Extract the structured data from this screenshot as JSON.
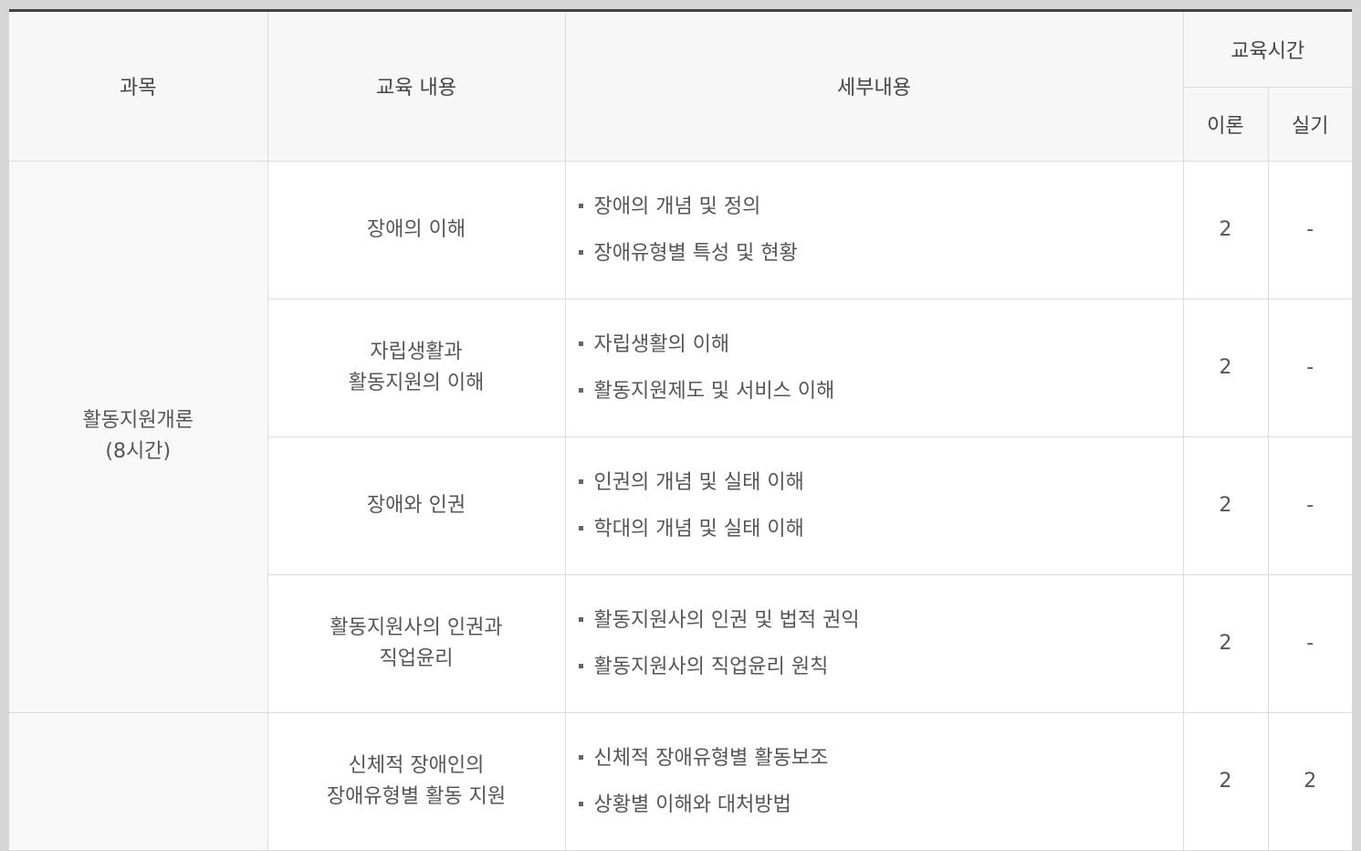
{
  "headers": {
    "subject": "과목",
    "content": "교육 내용",
    "detail": "세부내용",
    "hours": "교육시간",
    "theory": "이론",
    "practice": "실기"
  },
  "groups": [
    {
      "subject": [
        "활동지원개론",
        "(8시간)"
      ],
      "rows": [
        {
          "content": [
            "장애의 이해"
          ],
          "details": [
            "장애의 개념 및 정의",
            "장애유형별 특성 및 현황"
          ],
          "theory": "2",
          "practice": "-"
        },
        {
          "content": [
            "자립생활과",
            "활동지원의 이해"
          ],
          "details": [
            "자립생활의 이해",
            "활동지원제도 및 서비스 이해"
          ],
          "theory": "2",
          "practice": "-"
        },
        {
          "content": [
            "장애와 인권"
          ],
          "details": [
            "인권의 개념 및 실태 이해",
            "학대의 개념 및 실태 이해"
          ],
          "theory": "2",
          "practice": "-"
        },
        {
          "content": [
            "활동지원사의 인권과",
            "직업윤리"
          ],
          "details": [
            "활동지원사의 인권 및 법적 권익",
            "활동지원사의 직업윤리 원칙"
          ],
          "theory": "2",
          "practice": "-"
        }
      ]
    },
    {
      "subject": [],
      "rows": [
        {
          "content": [
            "신체적 장애인의",
            "장애유형별 활동 지원"
          ],
          "details": [
            "신체적 장애유형별 활동보조",
            "상황별 이해와 대처방법"
          ],
          "theory": "2",
          "practice": "2"
        }
      ]
    }
  ]
}
